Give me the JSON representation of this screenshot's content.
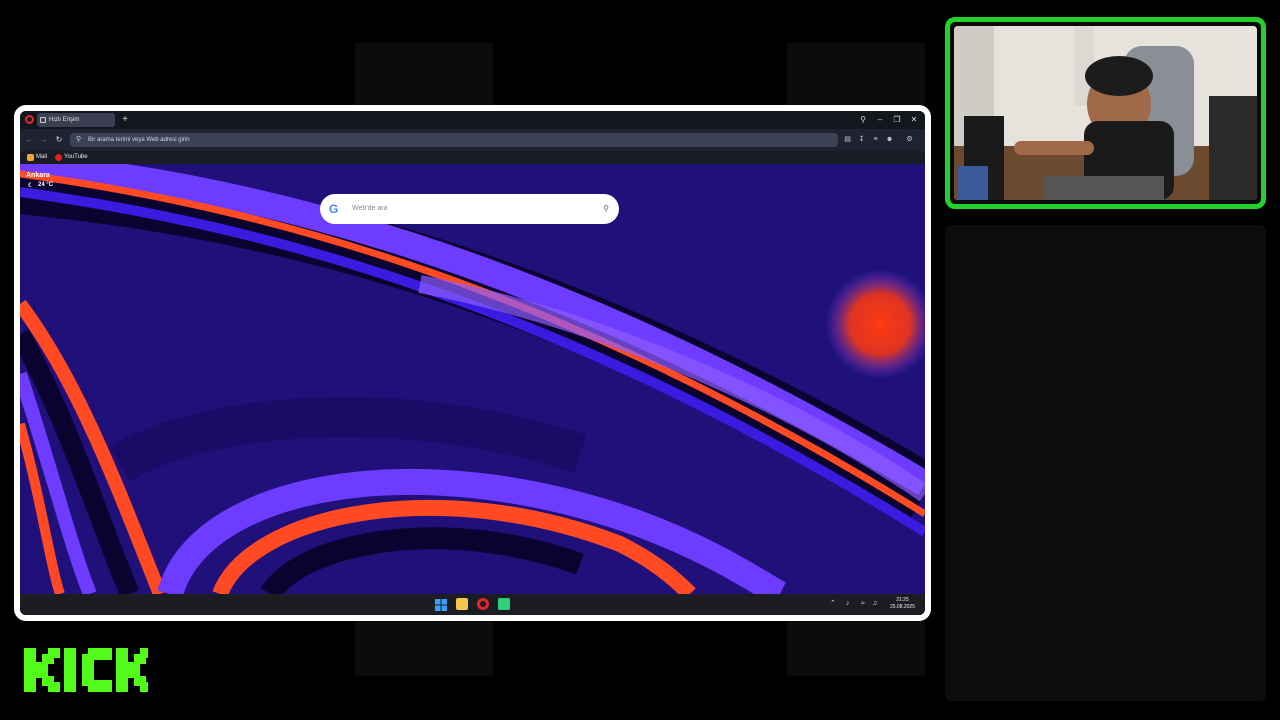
{
  "stream": {
    "logo_text": "KICK",
    "accent_color": "#23d12a"
  },
  "browser": {
    "tab_title": "Hızlı Erişim",
    "newtab_icon": "plus-icon",
    "address_placeholder": "Bir arama terimi veya Web adresi girin",
    "bookmarks": [
      {
        "label": "Mail",
        "icon": "mail-icon"
      },
      {
        "label": "YouTube",
        "icon": "youtube-icon"
      }
    ],
    "weather": {
      "city": "Ankara",
      "temp": "24 °C"
    },
    "search": {
      "logo": "G",
      "placeholder": "Web'de ara"
    }
  },
  "taskbar": {
    "time": "21:25",
    "date": "25.08.2025"
  }
}
